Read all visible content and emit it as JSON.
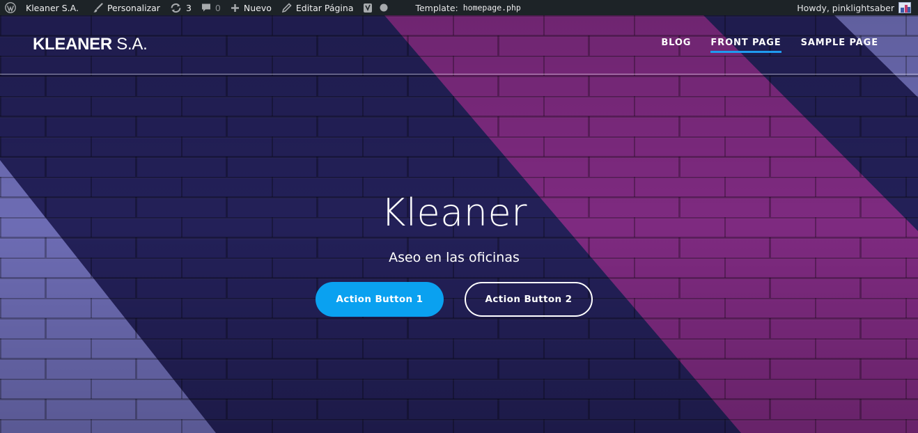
{
  "adminbar": {
    "wp_logo_icon": "wordpress-logo-icon",
    "site_name": "Kleaner S.A.",
    "customize": "Personalizar",
    "updates_count": "3",
    "comments_count": "0",
    "new": "Nuevo",
    "edit_page": "Editar Página",
    "template_label": "Template:",
    "template_file": "homepage.php",
    "howdy": "Howdy, pinklightsaber"
  },
  "header": {
    "title_bold": "KLEANER",
    "title_light": "S.A.",
    "nav": [
      {
        "label": "BLOG",
        "active": false
      },
      {
        "label": "FRONT PAGE",
        "active": true
      },
      {
        "label": "SAMPLE PAGE",
        "active": false
      }
    ]
  },
  "hero": {
    "title": "Kleaner",
    "subtitle": "Aseo en las oficinas",
    "button_primary": "Action Button 1",
    "button_secondary": "Action Button 2"
  },
  "colors": {
    "adminbar_bg": "#1d2327",
    "navy": "#232058",
    "magenta": "#7e2a80",
    "lavender": "#6d6cb4",
    "accent_blue": "#0aa1f0",
    "nav_underline": "#1f9bf0"
  }
}
